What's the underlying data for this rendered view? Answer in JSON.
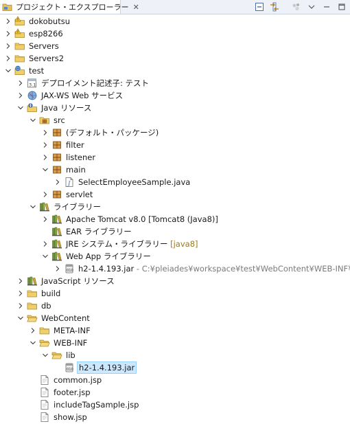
{
  "view": {
    "title": "プロジェクト・エクスプローラー",
    "close_glyph": "✕"
  },
  "toolbar": {
    "buttons": [
      "collapse-all-icon",
      "link-editor-icon",
      "filter-icon",
      "view-menu-icon",
      "minimize-icon",
      "maximize-icon"
    ]
  },
  "tree": [
    {
      "label": "dokobutsu",
      "depth": 0,
      "expanded": false,
      "icon": "project-warning-icon"
    },
    {
      "label": "esp8266",
      "depth": 0,
      "expanded": false,
      "icon": "project-warning-icon"
    },
    {
      "label": "Servers",
      "depth": 0,
      "expanded": false,
      "icon": "folder-icon"
    },
    {
      "label": "Servers2",
      "depth": 0,
      "expanded": false,
      "icon": "folder-icon"
    },
    {
      "label": "test",
      "depth": 0,
      "expanded": true,
      "icon": "web-project-icon"
    },
    {
      "label": "デプロイメント記述子: テスト",
      "depth": 1,
      "expanded": false,
      "icon": "deployment-descriptor-icon"
    },
    {
      "label": "JAX-WS Web サービス",
      "depth": 1,
      "expanded": false,
      "icon": "web-service-icon"
    },
    {
      "label": "Java リソース",
      "depth": 1,
      "expanded": true,
      "icon": "java-resources-icon"
    },
    {
      "label": "src",
      "depth": 2,
      "expanded": true,
      "icon": "source-folder-icon"
    },
    {
      "label": "(デフォルト・パッケージ)",
      "depth": 3,
      "expanded": false,
      "icon": "package-icon"
    },
    {
      "label": "filter",
      "depth": 3,
      "expanded": false,
      "icon": "package-icon"
    },
    {
      "label": "listener",
      "depth": 3,
      "expanded": false,
      "icon": "package-icon"
    },
    {
      "label": "main",
      "depth": 3,
      "expanded": true,
      "icon": "package-icon"
    },
    {
      "label": "SelectEmployeeSample.java",
      "depth": 4,
      "expanded": false,
      "icon": "java-file-icon"
    },
    {
      "label": "servlet",
      "depth": 3,
      "expanded": false,
      "icon": "package-icon"
    },
    {
      "label": "ライブラリー",
      "depth": 2,
      "expanded": true,
      "icon": "library-icon"
    },
    {
      "label": "Apache Tomcat v8.0 [Tomcat8 (Java8)]",
      "depth": 3,
      "expanded": false,
      "icon": "library-icon"
    },
    {
      "label": "EAR ライブラリー",
      "depth": 3,
      "expanded": null,
      "icon": "library-icon"
    },
    {
      "label": "JRE システム・ライブラリー",
      "suffix": " [java8]",
      "depth": 3,
      "expanded": false,
      "icon": "library-icon"
    },
    {
      "label": "Web App ライブラリー",
      "depth": 3,
      "expanded": true,
      "icon": "library-icon"
    },
    {
      "label": "h2-1.4.193.jar",
      "suffix": " - C:¥pleiades¥workspace¥test¥WebContent¥WEB-INF¥lib",
      "depth": 4,
      "expanded": false,
      "icon": "jar-icon"
    },
    {
      "label": "JavaScript リソース",
      "depth": 1,
      "expanded": false,
      "icon": "library-icon"
    },
    {
      "label": "build",
      "depth": 1,
      "expanded": false,
      "icon": "folder-icon"
    },
    {
      "label": "db",
      "depth": 1,
      "expanded": false,
      "icon": "folder-icon"
    },
    {
      "label": "WebContent",
      "depth": 1,
      "expanded": true,
      "icon": "folder-open-icon"
    },
    {
      "label": "META-INF",
      "depth": 2,
      "expanded": false,
      "icon": "folder-icon"
    },
    {
      "label": "WEB-INF",
      "depth": 2,
      "expanded": true,
      "icon": "folder-open-icon"
    },
    {
      "label": "lib",
      "depth": 3,
      "expanded": true,
      "icon": "folder-open-icon"
    },
    {
      "label": "h2-1.4.193.jar",
      "depth": 4,
      "expanded": null,
      "icon": "jar-icon",
      "selected": true
    },
    {
      "label": "common.jsp",
      "depth": 2,
      "expanded": null,
      "icon": "file-icon"
    },
    {
      "label": "footer.jsp",
      "depth": 2,
      "expanded": null,
      "icon": "file-icon"
    },
    {
      "label": "includeTagSample.jsp",
      "depth": 2,
      "expanded": null,
      "icon": "file-icon"
    },
    {
      "label": "show.jsp",
      "depth": 2,
      "expanded": null,
      "icon": "file-icon"
    }
  ],
  "colors": {
    "selection_bg": "#cce8ff",
    "selection_border": "#99d1ff",
    "decoration": "#9a7a1a",
    "path_decoration": "#7a7a7a",
    "folder": "#e8c25a",
    "package": "#b5651d"
  }
}
